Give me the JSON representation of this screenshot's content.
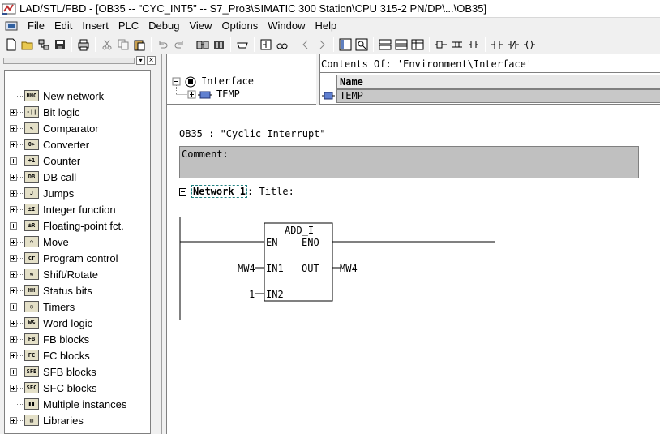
{
  "window": {
    "title": "LAD/STL/FBD  - [OB35 -- \"CYC_INT5\" -- S7_Pro3\\SIMATIC 300 Station\\CPU 315-2 PN/DP\\...\\OB35]"
  },
  "menu": {
    "items": [
      "File",
      "Edit",
      "Insert",
      "PLC",
      "Debug",
      "View",
      "Options",
      "Window",
      "Help"
    ]
  },
  "toolbar": {
    "buttons": [
      "new-icon",
      "open-icon",
      "accessible-nodes-icon",
      "save-icon",
      "print-icon",
      "cut-icon",
      "copy-icon",
      "paste-icon",
      "undo-icon",
      "redo-icon",
      "download-icon",
      "upload-icon",
      "module-icon",
      "monitor-icon",
      "overview-icon",
      "details-icon",
      "program-elements-icon",
      "call-structure-icon",
      "contact-no-icon",
      "contact-nc-icon",
      "coil-icon"
    ]
  },
  "tree": {
    "items": [
      {
        "label": "New network",
        "icon": "new-network-icon",
        "expandable": false
      },
      {
        "label": "Bit logic",
        "icon": "bit-logic-icon",
        "expandable": true
      },
      {
        "label": "Comparator",
        "icon": "comparator-icon",
        "expandable": true
      },
      {
        "label": "Converter",
        "icon": "converter-icon",
        "expandable": true
      },
      {
        "label": "Counter",
        "icon": "counter-icon",
        "expandable": true
      },
      {
        "label": "DB call",
        "icon": "db-call-icon",
        "expandable": true
      },
      {
        "label": "Jumps",
        "icon": "jumps-icon",
        "expandable": true
      },
      {
        "label": "Integer function",
        "icon": "integer-function-icon",
        "expandable": true
      },
      {
        "label": "Floating-point fct.",
        "icon": "floating-point-icon",
        "expandable": true
      },
      {
        "label": "Move",
        "icon": "move-icon",
        "expandable": true
      },
      {
        "label": "Program control",
        "icon": "program-control-icon",
        "expandable": true
      },
      {
        "label": "Shift/Rotate",
        "icon": "shift-rotate-icon",
        "expandable": true
      },
      {
        "label": "Status bits",
        "icon": "status-bits-icon",
        "expandable": true
      },
      {
        "label": "Timers",
        "icon": "timers-icon",
        "expandable": true
      },
      {
        "label": "Word logic",
        "icon": "word-logic-icon",
        "expandable": true
      },
      {
        "label": "FB blocks",
        "icon": "fb-blocks-icon",
        "expandable": true
      },
      {
        "label": "FC blocks",
        "icon": "fc-blocks-icon",
        "expandable": true
      },
      {
        "label": "SFB blocks",
        "icon": "sfb-blocks-icon",
        "expandable": true
      },
      {
        "label": "SFC blocks",
        "icon": "sfc-blocks-icon",
        "expandable": true
      },
      {
        "label": "Multiple instances",
        "icon": "multiple-instances-icon",
        "expandable": false
      },
      {
        "label": "Libraries",
        "icon": "libraries-icon",
        "expandable": true
      }
    ]
  },
  "interface": {
    "root": "Interface",
    "child": "TEMP",
    "contents_of": "Contents Of: 'Environment\\Interface'",
    "column_name": "Name",
    "row_value": "TEMP"
  },
  "editor": {
    "block_title": "OB35 :  \"Cyclic Interrupt\"",
    "comment_label": "Comment:",
    "network_label": "Network 1",
    "network_title": ": Title:",
    "box": {
      "name": "ADD_I",
      "en": "EN",
      "eno": "ENO",
      "in1": "IN1",
      "in2": "IN2",
      "out": "OUT",
      "in1_operand": "MW4",
      "in2_operand": "1",
      "out_operand": "MW4"
    }
  }
}
